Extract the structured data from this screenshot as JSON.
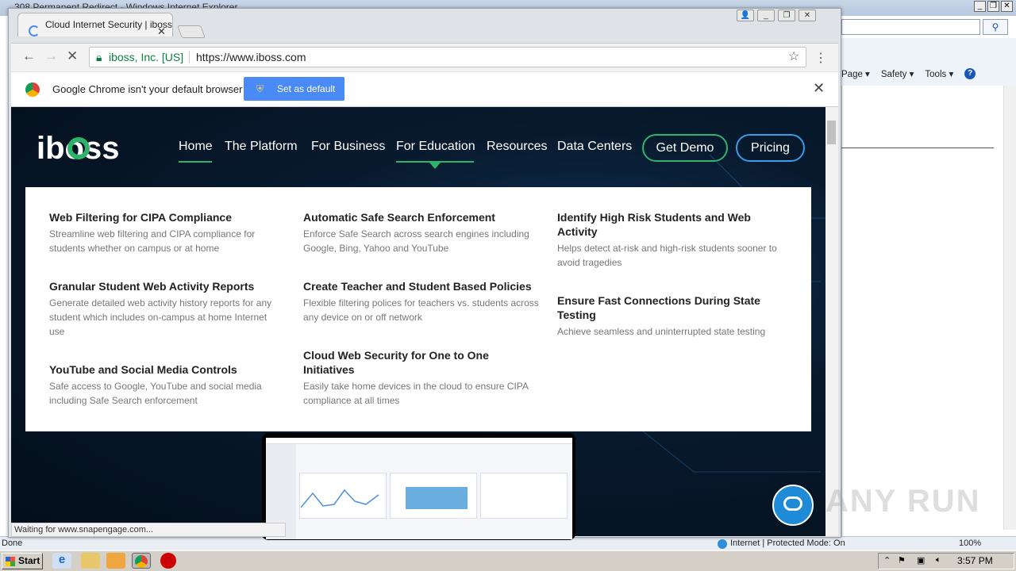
{
  "ie": {
    "title": "308 Permanent Redirect - Windows Internet Explorer",
    "commands": [
      "Page ▾",
      "Safety ▾",
      "Tools ▾"
    ],
    "status_left": "Done",
    "status_zone": "Internet | Protected Mode: On",
    "zoom": "100%"
  },
  "chrome": {
    "tab_title": "Cloud Internet Security | iboss",
    "security_label": "iboss, Inc. [US]",
    "url": "https://www.iboss.com",
    "infobar_text": "Google Chrome isn't your default browser",
    "set_default_label": "Set as default",
    "status_text": "Waiting for www.snapengage.com..."
  },
  "site": {
    "logo": "iboss",
    "nav": [
      "Home",
      "The Platform",
      "For Business",
      "For Education",
      "Resources",
      "Data Centers"
    ],
    "demo_label": "Get Demo",
    "pricing_label": "Pricing",
    "accent": "#2fb36a",
    "pricing_border": "#3b9be8"
  },
  "menu": {
    "col1": [
      {
        "title": "Web Filtering for CIPA Compliance",
        "desc": "Streamline web filtering and CIPA compliance for students whether on campus or at home"
      },
      {
        "title": "Granular Student Web Activity Reports",
        "desc": "Generate detailed web activity history reports for any student which includes on-campus at home Internet use"
      },
      {
        "title": "YouTube and Social Media Controls",
        "desc": "Safe access to Google, YouTube and social media including Safe Search enforcement"
      }
    ],
    "col2": [
      {
        "title": "Automatic Safe Search Enforcement",
        "desc": "Enforce Safe Search across search engines including Google, Bing, Yahoo and YouTube"
      },
      {
        "title": "Create Teacher and Student Based Policies",
        "desc": "Flexible filtering polices for teachers vs. students across any device on or off network"
      },
      {
        "title": "Cloud Web Security for One to One Initiatives",
        "desc": "Easily take home devices in the cloud to ensure CIPA compliance at all times"
      }
    ],
    "col3": [
      {
        "title": "Identify High Risk Students and Web Activity",
        "desc": "Helps detect at-risk and high-risk students sooner to avoid tragedies"
      },
      {
        "title": "Ensure Fast Connections During State Testing",
        "desc": "Achieve seamless and uninterrupted state testing"
      }
    ]
  },
  "taskbar": {
    "start_label": "Start",
    "clock": "3:57 PM"
  },
  "watermark": "ANY RUN"
}
